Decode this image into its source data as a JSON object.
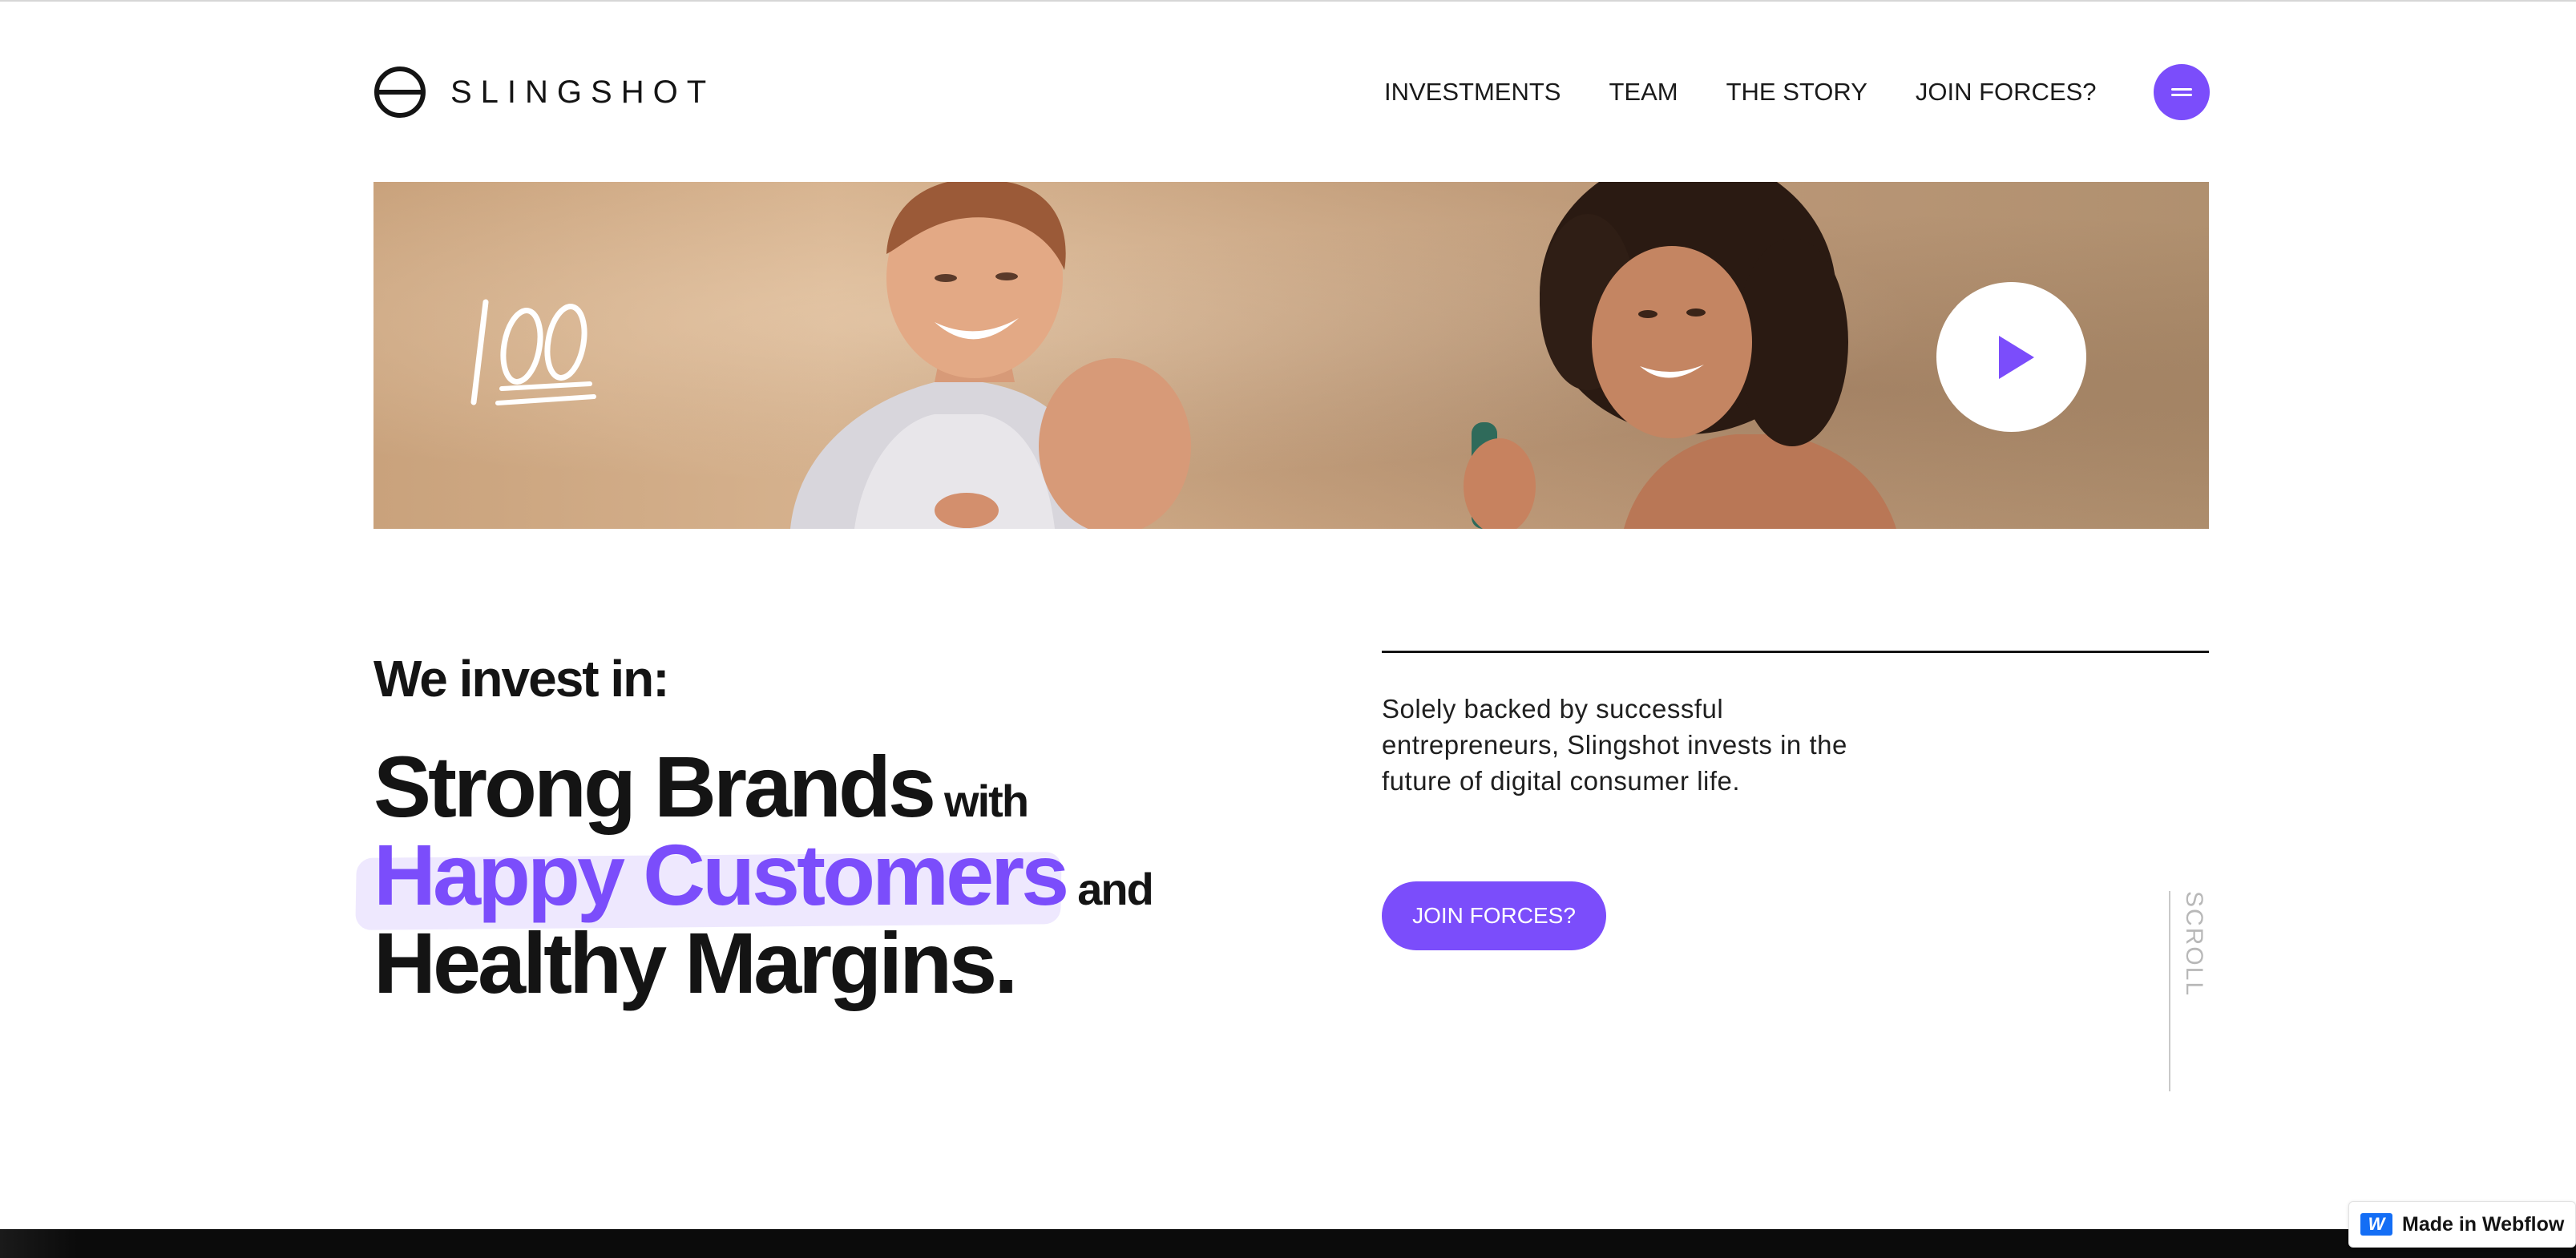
{
  "brand": {
    "name": "SLINGSHOT",
    "accent_color": "#7b4dfb"
  },
  "nav": {
    "items": [
      {
        "label": "INVESTMENTS"
      },
      {
        "label": "TEAM"
      },
      {
        "label": "THE STORY"
      },
      {
        "label": "JOIN FORCES?"
      }
    ],
    "menu_icon": "hamburger-icon"
  },
  "hero": {
    "badge_icon": "hundred-points-icon",
    "play_icon": "play-icon"
  },
  "content": {
    "eyebrow": "We invest in:",
    "line1_big": "Strong Brands",
    "line1_small": "with",
    "line2_big": "Happy Customers",
    "line2_small": "and",
    "line3_big": "Healthy Margins.",
    "description": "Solely backed by successful entrepreneurs, Slingshot invests in the future of digital consumer life.",
    "cta_label": "JOIN FORCES?",
    "scroll_label": "SCROLL"
  },
  "webflow_badge": {
    "label": "Made in Webflow",
    "icon": "webflow-logo-icon"
  }
}
